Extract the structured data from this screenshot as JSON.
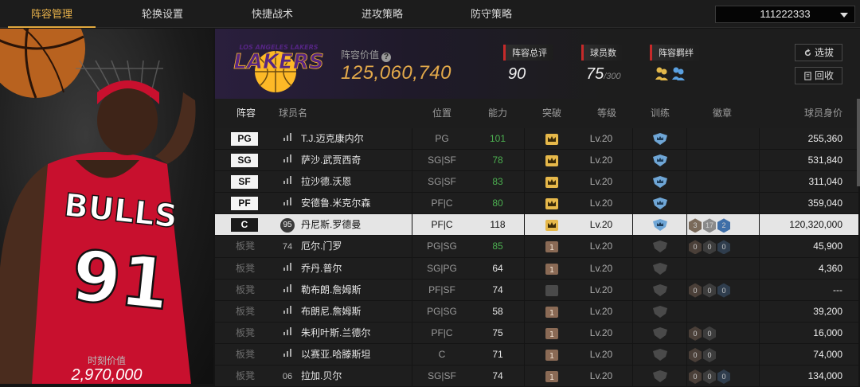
{
  "nav": {
    "tabs": [
      "阵容管理",
      "轮换设置",
      "快捷战术",
      "进攻策略",
      "防守策略"
    ],
    "active_index": 0,
    "account": "111222333"
  },
  "left": {
    "value_label": "时刻价值",
    "value": "2,970,000"
  },
  "header": {
    "team_logo_text": "LOS ANGELES LAKERS",
    "lineup_value_label": "阵容价值",
    "lineup_value": "125,060,740",
    "rating_label": "阵容总评",
    "rating": "90",
    "players_label": "球员数",
    "players_count": "75",
    "players_max": "/300",
    "bond_label": "阵容羁绊",
    "btn_select": "选拔",
    "btn_recycle": "回收"
  },
  "table": {
    "headers": [
      "阵容",
      "球员名",
      "位置",
      "能力",
      "突破",
      "等级",
      "训练",
      "徽章",
      "球员身价"
    ],
    "rows": [
      {
        "slot": "PG",
        "num": "",
        "name": "T.J.迈克康内尔",
        "position": "PG",
        "ability": "101",
        "ability_color": "#4caf50",
        "level": "Lv.20",
        "crown": "gold",
        "shield": "blue",
        "badges": [],
        "value": "255,360"
      },
      {
        "slot": "SG",
        "num": "",
        "name": "萨沙.武贾西奇",
        "position": "SG|SF",
        "ability": "78",
        "ability_color": "#4caf50",
        "level": "Lv.20",
        "crown": "gold",
        "shield": "blue",
        "badges": [],
        "value": "531,840"
      },
      {
        "slot": "SF",
        "num": "",
        "name": "拉沙德.沃恩",
        "position": "SG|SF",
        "ability": "83",
        "ability_color": "#4caf50",
        "level": "Lv.20",
        "crown": "gold",
        "shield": "blue",
        "badges": [],
        "value": "311,040"
      },
      {
        "slot": "PF",
        "num": "",
        "name": "安德鲁.米克尔森",
        "position": "PF|C",
        "ability": "80",
        "ability_color": "#4caf50",
        "level": "Lv.20",
        "crown": "gold",
        "shield": "blue",
        "badges": [],
        "value": "359,040"
      },
      {
        "slot": "C",
        "num": "95",
        "name": "丹尼斯.罗德曼",
        "position": "PF|C",
        "ability": "118",
        "ability_color": "#111111",
        "level": "Lv.20",
        "crown": "gold",
        "shield": "blue",
        "badges": [
          [
            "3",
            "#7a6a5a"
          ],
          [
            "17",
            "#8a8a8a"
          ],
          [
            "2",
            "#3f6fa8"
          ]
        ],
        "value": "120,320,000",
        "selected": true
      },
      {
        "slot": "板凳",
        "num": "74",
        "name": "厄尔.门罗",
        "position": "PG|SG",
        "ability": "85",
        "ability_color": "#4caf50",
        "level": "Lv.20",
        "crown": "bronze",
        "shield": "gray",
        "badges": [
          [
            "0",
            "#4a3f38"
          ],
          [
            "0",
            "#3d3d3d"
          ],
          [
            "0",
            "#2f3d4d"
          ]
        ],
        "value": "45,900"
      },
      {
        "slot": "板凳",
        "num": "",
        "name": "乔丹.普尔",
        "position": "SG|PG",
        "ability": "64",
        "ability_color": "#e6e6e6",
        "level": "Lv.20",
        "crown": "bronze",
        "shield": "gray",
        "badges": [],
        "value": "4,360"
      },
      {
        "slot": "板凳",
        "num": "",
        "name": "勒布朗.詹姆斯",
        "position": "PF|SF",
        "ability": "74",
        "ability_color": "#e6e6e6",
        "level": "Lv.20",
        "crown": "gray",
        "shield": "gray",
        "badges": [
          [
            "0",
            "#4a3f38"
          ],
          [
            "0",
            "#3d3d3d"
          ],
          [
            "0",
            "#2f3d4d"
          ]
        ],
        "value": "---"
      },
      {
        "slot": "板凳",
        "num": "",
        "name": "布朗尼.詹姆斯",
        "position": "PG|SG",
        "ability": "58",
        "ability_color": "#e6e6e6",
        "level": "Lv.20",
        "crown": "bronze",
        "shield": "gray",
        "badges": [],
        "value": "39,200"
      },
      {
        "slot": "板凳",
        "num": "",
        "name": "朱利叶斯.兰德尔",
        "position": "PF|C",
        "ability": "75",
        "ability_color": "#e6e6e6",
        "level": "Lv.20",
        "crown": "bronze",
        "shield": "gray",
        "badges": [
          [
            "0",
            "#4a3f38"
          ],
          [
            "0",
            "#3d3d3d"
          ]
        ],
        "value": "16,000"
      },
      {
        "slot": "板凳",
        "num": "",
        "name": "以赛亚.哈滕斯坦",
        "position": "C",
        "ability": "71",
        "ability_color": "#e6e6e6",
        "level": "Lv.20",
        "crown": "bronze",
        "shield": "gray",
        "badges": [
          [
            "0",
            "#4a3f38"
          ],
          [
            "0",
            "#3d3d3d"
          ]
        ],
        "value": "74,000"
      },
      {
        "slot": "板凳",
        "num": "06",
        "name": "拉加.贝尔",
        "position": "SG|SF",
        "ability": "74",
        "ability_color": "#e6e6e6",
        "level": "Lv.20",
        "crown": "bronze",
        "shield": "gray",
        "badges": [
          [
            "0",
            "#4a3f38"
          ],
          [
            "0",
            "#3d3d3d"
          ],
          [
            "0",
            "#2f3d4d"
          ]
        ],
        "value": "134,000"
      }
    ]
  },
  "colors": {
    "accent": "#e0a83e",
    "stat_marker": "#c62a2a",
    "ability_green": "#4caf50",
    "lakers_purple": "#552583",
    "lakers_gold": "#fdb927",
    "bulls_red": "#ce1141"
  }
}
